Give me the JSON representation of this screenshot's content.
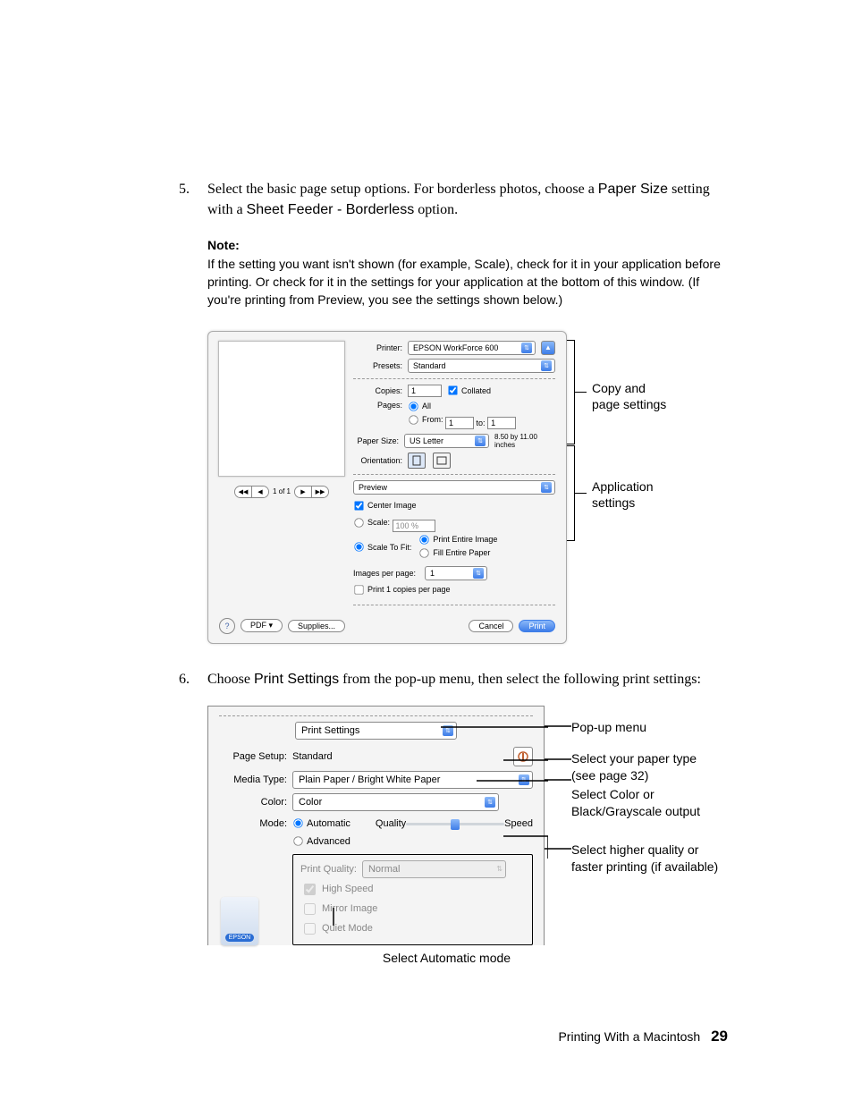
{
  "step5": {
    "number": "5.",
    "text_a": "Select the basic page setup options. For borderless photos, choose a ",
    "paper_size": "Paper Size",
    "text_b": " setting with a ",
    "sheet_feeder": "Sheet Feeder - Borderless",
    "text_c": " option."
  },
  "note": {
    "title": "Note:",
    "body_a": "If the setting you want isn't shown (for example, ",
    "scale": "Scale",
    "body_b": "), check for it in your application before printing. Or check for it in the settings for your application at the bottom of this window. (If you're printing from Preview, you see the settings shown below.)"
  },
  "dialog": {
    "printer_label": "Printer:",
    "printer_value": "EPSON WorkForce 600",
    "presets_label": "Presets:",
    "presets_value": "Standard",
    "copies_label": "Copies:",
    "copies_value": "1",
    "collated_label": "Collated",
    "pages_label": "Pages:",
    "pages_all": "All",
    "pages_from": "From:",
    "from_value": "1",
    "pages_to": "to:",
    "to_value": "1",
    "paper_size_label": "Paper Size:",
    "paper_size_value": "US Letter",
    "paper_dims": "8.50 by 11.00 inches",
    "orientation_label": "Orientation:",
    "section_menu": "Preview",
    "center_image": "Center Image",
    "scale_label": "Scale:",
    "scale_value": "100 %",
    "scale_to_fit": "Scale To Fit:",
    "print_entire": "Print Entire Image",
    "fill_entire": "Fill Entire Paper",
    "images_per_page_label": "Images per page:",
    "images_per_page_value": "1",
    "print_copies_per_page": "Print 1 copies per page",
    "nav_page": "1 of 1",
    "help": "?",
    "pdf": "PDF ▾",
    "supplies": "Supplies...",
    "cancel": "Cancel",
    "print": "Print"
  },
  "annot1": {
    "copy_line1": "Copy and",
    "copy_line2": "page settings",
    "app_line1": "Application",
    "app_line2": "settings"
  },
  "step6": {
    "number": "6.",
    "text_a": "Choose ",
    "print_settings": "Print Settings",
    "text_b": " from the pop-up menu, then select the following print settings:"
  },
  "ps": {
    "menu": "Print Settings",
    "page_setup_label": "Page Setup:",
    "page_setup_value": "Standard",
    "media_type_label": "Media Type:",
    "media_type_value": "Plain Paper / Bright White Paper",
    "color_label": "Color:",
    "color_value": "Color",
    "mode_label": "Mode:",
    "mode_automatic": "Automatic",
    "mode_advanced": "Advanced",
    "quality_label": "Quality",
    "speed_label": "Speed",
    "print_quality_label": "Print Quality:",
    "print_quality_value": "Normal",
    "high_speed": "High Speed",
    "mirror_image": "Mirror Image",
    "quiet_mode": "Quiet Mode",
    "badge": "EPSON"
  },
  "annot2": {
    "popup": "Pop-up menu",
    "paper1": "Select your paper type",
    "paper2": "(see page 32)",
    "color_a": "Select ",
    "color_b": "Color",
    "color_c": " or ",
    "color_d": "Black/Grayscale",
    "color_e": " output",
    "hq_a": "Select higher quality or",
    "hq_b": "faster printing (if available)",
    "auto_a": "Select ",
    "auto_b": "Automatic",
    "auto_c": " mode"
  },
  "footer": {
    "title": "Printing With a Macintosh",
    "page": "29"
  }
}
